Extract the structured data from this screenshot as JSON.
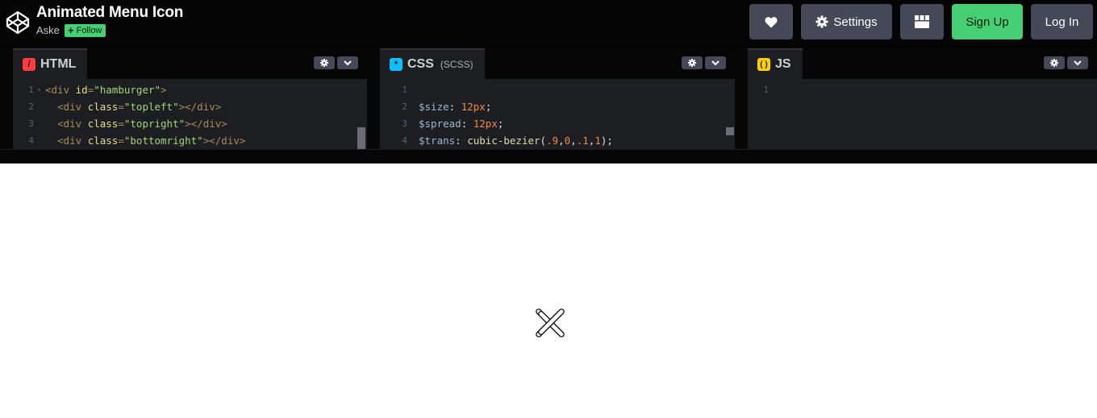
{
  "header": {
    "title": "Animated Menu Icon",
    "author": "Aske",
    "follow_label": "Follow",
    "settings_label": "Settings",
    "signup_label": "Sign Up",
    "login_label": "Log In"
  },
  "editors": {
    "html": {
      "name": "HTML",
      "icon_color": "#ff3c41"
    },
    "css": {
      "name": "CSS",
      "sub": "(SCSS)",
      "icon_color": "#0ebeff"
    },
    "js": {
      "name": "JS",
      "icon_color": "#fcd000"
    }
  },
  "code": {
    "html_lines": [
      {
        "n": "1",
        "parts": [
          [
            "t-tag",
            "<div "
          ],
          [
            "t-attr",
            "id"
          ],
          [
            "t-tag",
            "="
          ],
          [
            "t-str",
            "\"hamburger\""
          ],
          [
            "t-tag",
            ">"
          ]
        ]
      },
      {
        "n": "2",
        "parts": [
          [
            "t-plain",
            "  "
          ],
          [
            "t-tag",
            "<div "
          ],
          [
            "t-attr",
            "class"
          ],
          [
            "t-tag",
            "="
          ],
          [
            "t-str",
            "\"topleft\""
          ],
          [
            "t-tag",
            "></div>"
          ]
        ]
      },
      {
        "n": "3",
        "parts": [
          [
            "t-plain",
            "  "
          ],
          [
            "t-tag",
            "<div "
          ],
          [
            "t-attr",
            "class"
          ],
          [
            "t-tag",
            "="
          ],
          [
            "t-str",
            "\"topright\""
          ],
          [
            "t-tag",
            "></div>"
          ]
        ]
      },
      {
        "n": "4",
        "parts": [
          [
            "t-plain",
            "  "
          ],
          [
            "t-tag",
            "<div "
          ],
          [
            "t-attr",
            "class"
          ],
          [
            "t-tag",
            "="
          ],
          [
            "t-str",
            "\"bottomright\""
          ],
          [
            "t-tag",
            "></div>"
          ]
        ]
      }
    ],
    "css_lines": [
      {
        "n": "1",
        "parts": []
      },
      {
        "n": "2",
        "parts": [
          [
            "t-var",
            "$size"
          ],
          [
            "t-plain",
            ": "
          ],
          [
            "t-num",
            "12px"
          ],
          [
            "t-plain",
            ";"
          ]
        ]
      },
      {
        "n": "3",
        "parts": [
          [
            "t-var",
            "$spread"
          ],
          [
            "t-plain",
            ": "
          ],
          [
            "t-num",
            "12px"
          ],
          [
            "t-plain",
            ";"
          ]
        ]
      },
      {
        "n": "4",
        "parts": [
          [
            "t-var",
            "$trans"
          ],
          [
            "t-plain",
            ": "
          ],
          [
            "t-fn",
            "cubic-bezier"
          ],
          [
            "t-plain",
            "("
          ],
          [
            "t-num",
            ".9"
          ],
          [
            "t-plain",
            ","
          ],
          [
            "t-num",
            "0"
          ],
          [
            "t-plain",
            ","
          ],
          [
            "t-num",
            ".1"
          ],
          [
            "t-plain",
            ","
          ],
          [
            "t-num",
            "1"
          ],
          [
            "t-plain",
            ");"
          ]
        ]
      }
    ],
    "js_lines": [
      {
        "n": "1",
        "parts": []
      }
    ]
  }
}
